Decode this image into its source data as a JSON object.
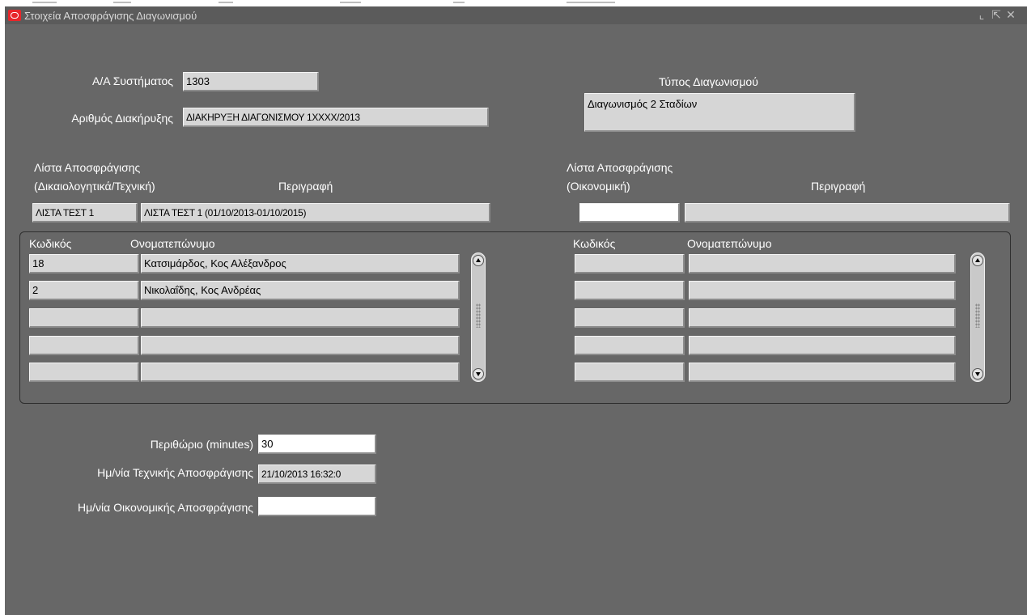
{
  "window": {
    "title": "Στοιχεία Αποσφράγισης Διαγωνισμού",
    "controls": [
      "⌞",
      "⇱",
      "✕"
    ]
  },
  "system_id": {
    "label": "Α/Α Συστήματος",
    "value": "1303"
  },
  "declaration": {
    "label": "Αριθμός Διακήρυξης",
    "value": "ΔΙΑΚΗΡΥΞΗ ΔΙΑΓΩΝΙΣΜΟΥ 1ΧΧΧΧ/2013"
  },
  "tender_type": {
    "label": "Τύπος Διαγωνισμού",
    "value": "Διαγωνισμός 2 Σταδίων"
  },
  "tech_list": {
    "label_line1": "Λίστα Αποσφράγισης",
    "label_line2": "(Δικαιολογητικά/Τεχνική)",
    "desc_label": "Περιγραφή",
    "code": "ΛΙΣΤΑ ΤΕΣΤ 1",
    "description": "ΛΙΣΤΑ ΤΕΣΤ 1 (01/10/2013-01/10/2015)"
  },
  "fin_list": {
    "label_line1": "Λίστα Αποσφράγισης",
    "label_line2": "(Οικονομική)",
    "desc_label": "Περιγραφή",
    "code": "",
    "description": ""
  },
  "tech_members": {
    "code_header": "Κωδικός",
    "name_header": "Ονοματεπώνυμο",
    "rows": [
      {
        "code": "18",
        "name": "Κατσιμάρδος, Κος Αλέξανδρος"
      },
      {
        "code": "2",
        "name": "Νικολαΐδης, Κος Ανδρέας"
      },
      {
        "code": "",
        "name": ""
      },
      {
        "code": "",
        "name": ""
      },
      {
        "code": "",
        "name": ""
      }
    ]
  },
  "fin_members": {
    "code_header": "Κωδικός",
    "name_header": "Ονοματεπώνυμο",
    "rows": [
      {
        "code": "",
        "name": ""
      },
      {
        "code": "",
        "name": ""
      },
      {
        "code": "",
        "name": ""
      },
      {
        "code": "",
        "name": ""
      },
      {
        "code": "",
        "name": ""
      }
    ]
  },
  "margin": {
    "label": "Περιθώριο (minutes)",
    "value": "30"
  },
  "tech_open_date": {
    "label": "Ημ/νία Τεχνικής Αποσφράγισης",
    "value": "21/10/2013 16:32:0"
  },
  "fin_open_date": {
    "label": "Ημ/νία Οικονομικής Αποσφράγισης",
    "value": ""
  }
}
